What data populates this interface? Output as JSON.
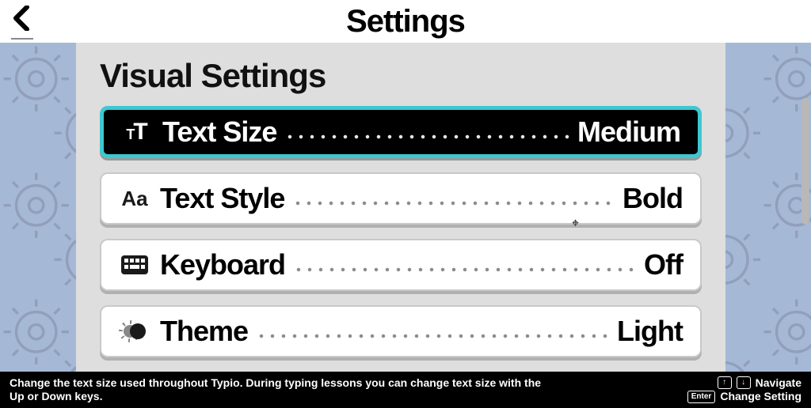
{
  "header": {
    "title": "Settings"
  },
  "section": {
    "title": "Visual Settings"
  },
  "settings": [
    {
      "icon": "text-size-icon",
      "label": "Text Size",
      "value": "Medium",
      "selected": true
    },
    {
      "icon": "text-style-icon",
      "label": "Text Style",
      "value": "Bold",
      "selected": false
    },
    {
      "icon": "keyboard-icon",
      "label": "Keyboard",
      "value": "Off",
      "selected": false
    },
    {
      "icon": "theme-icon",
      "label": "Theme",
      "value": "Light",
      "selected": false
    }
  ],
  "footer": {
    "hint": "Change the text size used throughout Typio. During typing lessons you can change text size with the Up or Down keys.",
    "nav_label": "Navigate",
    "change_label": "Change Setting",
    "up_key": "↑",
    "down_key": "↓",
    "enter_key": "Enter"
  }
}
